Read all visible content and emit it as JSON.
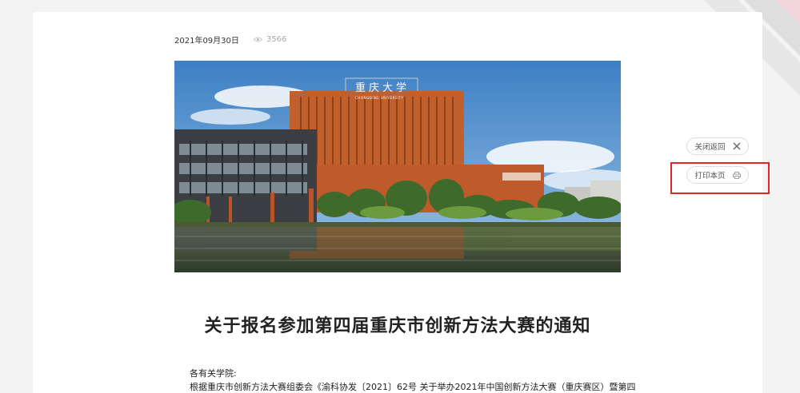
{
  "article": {
    "date": "2021年09月30日",
    "views": "3566",
    "title": "关于报名参加第四届重庆市创新方法大赛的通知",
    "body_lines": [
      "各有关学院:",
      "根据重庆市创新方法大赛组委会《渝科协发〔2021〕62号 关于举办2021年中国创新方法大赛（重庆赛区）暨第四"
    ],
    "hero_sign": "重庆大学",
    "hero_sign_sub": "CHONGQING UNIVERSITY"
  },
  "side_actions": {
    "close_label": "关闭返回",
    "print_label": "打印本页"
  },
  "colors": {
    "highlight": "#e3242b",
    "background": "#f3f3f3",
    "stripe_gray": "#dddddd",
    "stripe_pink": "#f2d5dc"
  },
  "icons": {
    "views": "eye-icon",
    "close": "close-icon",
    "print": "print-icon"
  }
}
